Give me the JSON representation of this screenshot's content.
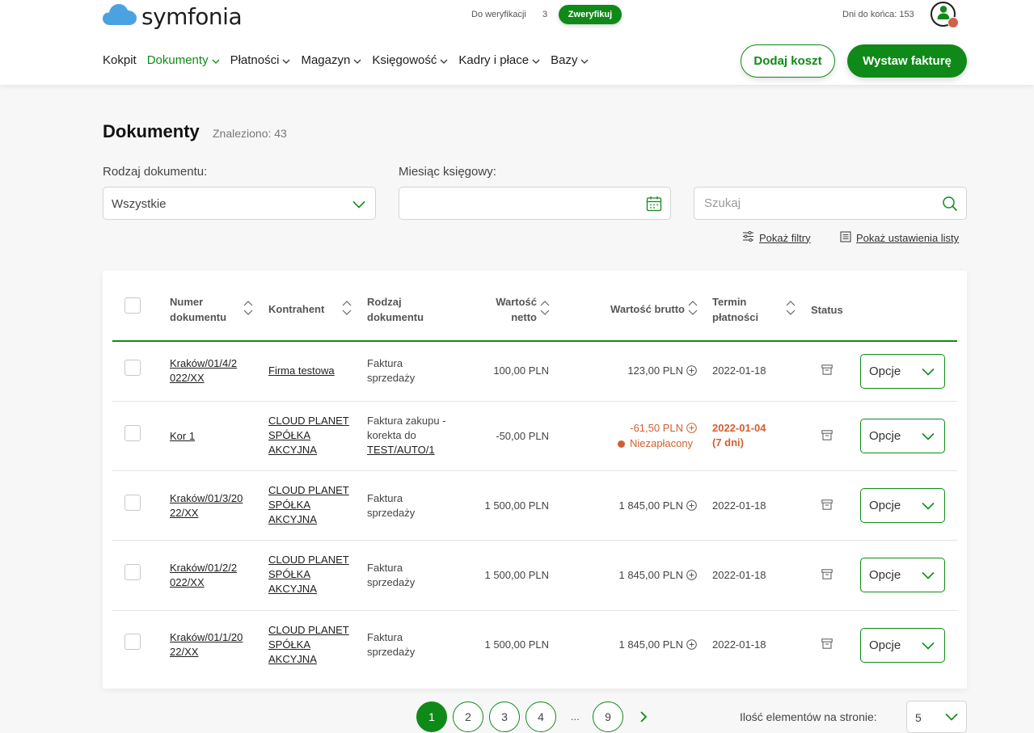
{
  "brand": {
    "name": "symfonia"
  },
  "topbar": {
    "verify_label": "Do weryfikacji",
    "verify_count": "3",
    "verify_button": "Zweryfikuj",
    "days_left": "Dni do końca: 153"
  },
  "nav": [
    {
      "label": "Kokpit",
      "dropdown": false,
      "active": false
    },
    {
      "label": "Dokumenty",
      "dropdown": true,
      "active": true
    },
    {
      "label": "Płatności",
      "dropdown": true,
      "active": false
    },
    {
      "label": "Magazyn",
      "dropdown": true,
      "active": false
    },
    {
      "label": "Księgowość",
      "dropdown": true,
      "active": false
    },
    {
      "label": "Kadry i płace",
      "dropdown": true,
      "active": false
    },
    {
      "label": "Bazy",
      "dropdown": true,
      "active": false
    }
  ],
  "actions": {
    "add_cost": "Dodaj koszt",
    "issue_invoice": "Wystaw fakturę"
  },
  "page": {
    "title": "Dokumenty",
    "found": "Znaleziono: 43"
  },
  "filters": {
    "doc_type_label": "Rodzaj dokumentu:",
    "doc_type_value": "Wszystkie",
    "month_label": "Miesiąc księgowy:",
    "month_value": "",
    "search_placeholder": "Szukaj",
    "show_filters": "Pokaż filtry",
    "show_list_settings": "Pokaż ustawienia listy"
  },
  "table": {
    "headers": {
      "number": [
        "Numer",
        "dokumentu"
      ],
      "contractor": "Kontrahent",
      "type": [
        "Rodzaj",
        "dokumentu"
      ],
      "net": [
        "Wartość",
        "netto"
      ],
      "gross": "Wartość brutto",
      "due": [
        "Termin",
        "płatności"
      ],
      "status": "Status"
    },
    "rows": [
      {
        "number": [
          "Kraków/01/4/2",
          "022/XX"
        ],
        "contractor": [
          "Firma testowa"
        ],
        "type": [
          "Faktura",
          "sprzedaży"
        ],
        "type_link": "",
        "net": "100,00 PLN",
        "gross": "123,00 PLN",
        "gross_warn": false,
        "payment_status": "",
        "due": [
          "2022-01-18"
        ],
        "due_warn": false,
        "options": "Opcje"
      },
      {
        "number": [
          "Kor 1"
        ],
        "contractor": [
          "CLOUD PLANET",
          "SPÓŁKA",
          "AKCYJNA"
        ],
        "type": [
          "Faktura zakupu -",
          "korekta do"
        ],
        "type_link": "TEST/AUTO/1",
        "net": "-50,00 PLN",
        "gross": "-61,50 PLN",
        "gross_warn": true,
        "payment_status": "Niezapłacony",
        "due": [
          "2022-01-04",
          "(7 dni)"
        ],
        "due_warn": true,
        "options": "Opcje"
      },
      {
        "number": [
          "Kraków/01/3/20",
          "22/XX"
        ],
        "contractor": [
          "CLOUD PLANET",
          "SPÓŁKA",
          "AKCYJNA"
        ],
        "type": [
          "Faktura",
          "sprzedaży"
        ],
        "type_link": "",
        "net": "1 500,00 PLN",
        "gross": "1 845,00 PLN",
        "gross_warn": false,
        "payment_status": "",
        "due": [
          "2022-01-18"
        ],
        "due_warn": false,
        "options": "Opcje"
      },
      {
        "number": [
          "Kraków/01/2/2",
          "022/XX"
        ],
        "contractor": [
          "CLOUD PLANET",
          "SPÓŁKA",
          "AKCYJNA"
        ],
        "type": [
          "Faktura",
          "sprzedaży"
        ],
        "type_link": "",
        "net": "1 500,00 PLN",
        "gross": "1 845,00 PLN",
        "gross_warn": false,
        "payment_status": "",
        "due": [
          "2022-01-18"
        ],
        "due_warn": false,
        "options": "Opcje"
      },
      {
        "number": [
          "Kraków/01/1/20",
          "22/XX"
        ],
        "contractor": [
          "CLOUD PLANET",
          "SPÓŁKA",
          "AKCYJNA"
        ],
        "type": [
          "Faktura",
          "sprzedaży"
        ],
        "type_link": "",
        "net": "1 500,00 PLN",
        "gross": "1 845,00 PLN",
        "gross_warn": false,
        "payment_status": "",
        "due": [
          "2022-01-18"
        ],
        "due_warn": false,
        "options": "Opcje"
      }
    ]
  },
  "pagination": {
    "pages": [
      "1",
      "2",
      "3",
      "4"
    ],
    "ellipsis": "...",
    "last": "9",
    "current": "1",
    "per_page_label": "Ilość elementów na stronie:",
    "per_page_value": "5"
  },
  "colors": {
    "brand_green": "#0f8a18",
    "warning": "#d35f2e",
    "cloud_blue": "#4aa3e0"
  },
  "icons": [
    "cloud-logo-icon",
    "user-avatar-icon",
    "chevron-down-icon",
    "calendar-icon",
    "search-icon",
    "sliders-icon",
    "list-icon",
    "sort-arrows-icon",
    "plus-circle-icon",
    "archive-icon",
    "chevron-right-icon"
  ]
}
